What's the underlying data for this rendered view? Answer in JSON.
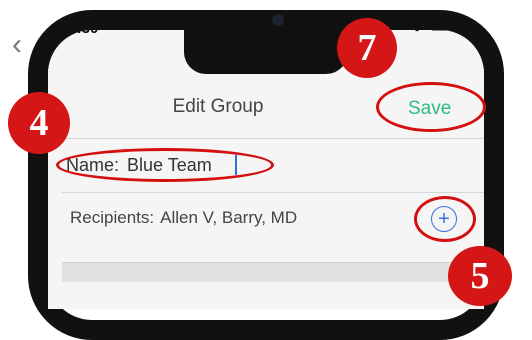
{
  "status_bar": {
    "time": "10:30"
  },
  "navbar": {
    "title": "Edit Group",
    "save_label": "Save"
  },
  "form": {
    "name_label": "Name:",
    "name_value": "Blue Team",
    "recipients_label": "Recipients:",
    "recipients_value": "Allen V, Barry, MD",
    "add_icon": "plus-circle-icon"
  },
  "annotations": {
    "badge_4": "4",
    "badge_5": "5",
    "badge_7": "7"
  },
  "colors": {
    "accent_save": "#2dbb84",
    "accent_add": "#3b6ee8",
    "annotation_red": "#d41616"
  }
}
